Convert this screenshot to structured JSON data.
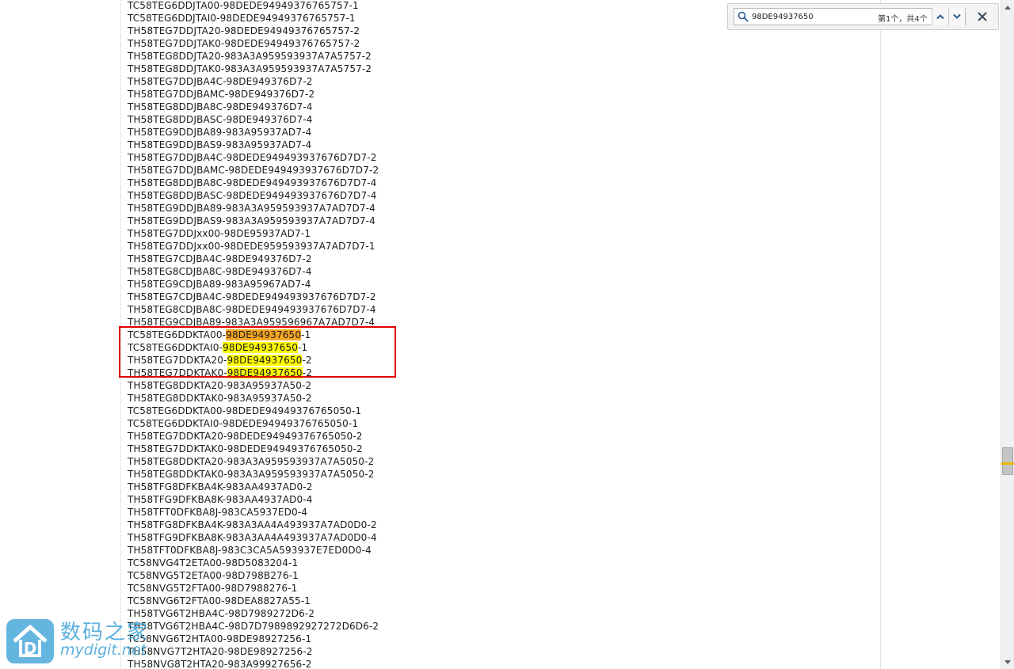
{
  "lines": [
    {
      "pre": "TC58TEG6DDJTA00-98DEDE9494937676575​7-1"
    },
    {
      "pre": "TC58TEG6DDJTAI0-98DEDE94949376765757-1"
    },
    {
      "pre": "TH58TEG7DDJTA20-98DEDE94949376765757-2"
    },
    {
      "pre": "TH58TEG7DDJTAK0-98DEDE94949376765757-2"
    },
    {
      "pre": "TH58TEG8DDJTA20-983A3A959593937A7A5757-2"
    },
    {
      "pre": "TH58TEG8DDJTAK0-983A3A959593937A7A5757-2"
    },
    {
      "pre": "TH58TEG7DDJBA4C-98DE949376D7-2"
    },
    {
      "pre": "TH58TEG7DDJBAMC-98DE949376D7-2"
    },
    {
      "pre": "TH58TEG8DDJBA8C-98DE949376D7-4"
    },
    {
      "pre": "TH58TEG8DDJBASC-98DE949376D7-4"
    },
    {
      "pre": "TH58TEG9DDJBA89-983A95937AD7-4"
    },
    {
      "pre": "TH58TEG9DDJBAS9-983A95937AD7-4"
    },
    {
      "pre": "TH58TEG7DDJBA4C-98DEDE949493937676D7D7-2"
    },
    {
      "pre": "TH58TEG7DDJBAMC-98DEDE949493937676D7D7-2"
    },
    {
      "pre": "TH58TEG8DDJBA8C-98DEDE949493937676D7D7-4"
    },
    {
      "pre": "TH58TEG8DDJBASC-98DEDE949493937676D7D7-4"
    },
    {
      "pre": "TH58TEG9DDJBA89-983A3A959593937A7AD7D7-4"
    },
    {
      "pre": "TH58TEG9DDJBAS9-983A3A959593937A7AD7D7-4"
    },
    {
      "pre": "TH58TEG7DDJxx00-98DE95937AD7-1"
    },
    {
      "pre": "TH58TEG7DDJxx00-98DEDE959593937A7AD7D7-1"
    },
    {
      "pre": "TH58TEG7CDJBA4C-98DE949376D7-2"
    },
    {
      "pre": "TH58TEG8CDJBA8C-98DE949376D7-4"
    },
    {
      "pre": "TH58TEG9CDJBA89-983A95967AD7-4"
    },
    {
      "pre": "TH58TEG7CDJBA4C-98DEDE949493937676D7D7-2"
    },
    {
      "pre": "TH58TEG8CDJBA8C-98DEDE949493937676D7D7-4"
    },
    {
      "pre": "TH58TEG9CDJBA89-983A3A959596967A7AD7D7-4"
    },
    {
      "pre": "TC58TEG6DDKTA00-",
      "match": "98DE94937650",
      "post": "-1",
      "current": true
    },
    {
      "pre": "TC58TEG6DDKTAI0-",
      "match": "98DE94937650",
      "post": "-1"
    },
    {
      "pre": "TH58TEG7DDKTA20-",
      "match": "98DE94937650",
      "post": "-2"
    },
    {
      "pre": "TH58TEG7DDKTAK0-",
      "match": "98DE94937650",
      "post": "-2"
    },
    {
      "pre": "TH58TEG8DDKTA20-983A95937A50-2"
    },
    {
      "pre": "TH58TEG8DDKTAK0-983A95937A50-2"
    },
    {
      "pre": "TC58TEG6DDKTA00-98DEDE94949376765050-1"
    },
    {
      "pre": "TC58TEG6DDKTAI0-98DEDE94949376765050-1"
    },
    {
      "pre": "TH58TEG7DDKTA20-98DEDE94949376765050-2"
    },
    {
      "pre": "TH58TEG7DDKTAK0-98DEDE94949376765050-2"
    },
    {
      "pre": "TH58TEG8DDKTA20-983A3A959593937A7A5050-2"
    },
    {
      "pre": "TH58TEG8DDKTAK0-983A3A959593937A7A5050-2"
    },
    {
      "pre": "TH58TFG8DFKBA4K-983AA4937AD0-2"
    },
    {
      "pre": "TH58TFG9DFKBA8K-983AA4937AD0-4"
    },
    {
      "pre": "TH58TFT0DFKBA8J-983CA5937ED0-4"
    },
    {
      "pre": "TH58TFG8DFKBA4K-983A3AA4A493937A7AD0D0-2"
    },
    {
      "pre": "TH58TFG9DFKBA8K-983A3AA4A493937A7AD0D0-4"
    },
    {
      "pre": "TH58TFT0DFKBA8J-983C3CA5A593937E7ED0D0-4"
    },
    {
      "pre": "TC58NVG4T2ETA00-98D5083204-1"
    },
    {
      "pre": "TC58NVG5T2ETA00-98D798B276-1"
    },
    {
      "pre": "TC58NVG5T2FTA00-98D7988276-1"
    },
    {
      "pre": "TC58NVG6T2FTA00-98DEA8827A55-1"
    },
    {
      "pre": "TH58TVG6T2HBA4C-98D7989272D6-2"
    },
    {
      "pre": "TH58TVG6T2HBA4C-98D7D7989892927272D6D6-2"
    },
    {
      "pre": "TC58NVG6T2HTA00-98DE98927256-1"
    },
    {
      "pre": "TH58NVG7T2HTA20-98DE98927256-2"
    },
    {
      "pre": "TH58NVG8T2HTA20-983A99927656-2"
    }
  ],
  "find": {
    "query": "98DE94937650",
    "count_text": "第1个，共4个",
    "icons": {
      "search": "search-icon",
      "prev": "chevron-up-icon",
      "next": "chevron-down-icon",
      "close": "close-icon"
    }
  },
  "watermark": {
    "cn": "数码之家",
    "en": "mydigit.net"
  },
  "colors": {
    "highlight": "#ffff00",
    "highlight_current": "#f5a623",
    "annotation_box": "#e00000",
    "watermark": "#4aa8dc"
  }
}
